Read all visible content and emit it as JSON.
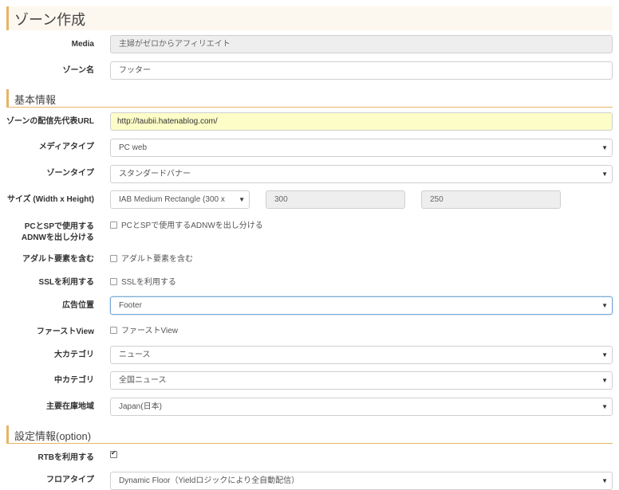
{
  "page": {
    "title": "ゾーン作成"
  },
  "fields": {
    "media": {
      "label": "Media",
      "value": "主婦がゼロからアフィリエイト"
    },
    "zone_name": {
      "label": "ゾーン名",
      "value": "フッター"
    }
  },
  "sections": {
    "basic": {
      "title": "基本情報"
    },
    "settings": {
      "title": "設定情報(option)"
    }
  },
  "basic": {
    "url": {
      "label": "ゾーンの配信先代表URL",
      "value": "http://taubii.hatenablog.com/"
    },
    "media_type": {
      "label": "メディアタイプ",
      "value": "PC web"
    },
    "zone_type": {
      "label": "ゾーンタイプ",
      "value": "スタンダードバナー"
    },
    "size": {
      "label": "サイズ (Width x Height)",
      "value": "IAB Medium Rectangle (300 x",
      "width": "300",
      "height": "250"
    },
    "split_adnw": {
      "label_line1": "PCとSPで使用する",
      "label_line2": "ADNWを出し分ける",
      "checkbox_label": "PCとSPで使用するADNWを出し分ける",
      "checked": false
    },
    "adult": {
      "label": "アダルト要素を含む",
      "checkbox_label": "アダルト要素を含む",
      "checked": false
    },
    "ssl": {
      "label": "SSLを利用する",
      "checkbox_label": "SSLを利用する",
      "checked": false
    },
    "ad_position": {
      "label": "広告位置",
      "value": "Footer"
    },
    "first_view": {
      "label": "ファーストView",
      "checkbox_label": "ファーストView",
      "checked": false
    },
    "category_main": {
      "label": "大カテゴリ",
      "value": "ニュース"
    },
    "category_sub": {
      "label": "中カテゴリ",
      "value": "全国ニュース"
    },
    "region": {
      "label": "主要在庫地域",
      "value": "Japan(日本)"
    }
  },
  "settings": {
    "rtb": {
      "label": "RTBを利用する",
      "checked": true
    },
    "floor_type": {
      "label": "フロアタイプ",
      "value": "Dynamic Floor（Yieldロジックにより全自動配信）"
    }
  },
  "icons": {
    "caret": "▼",
    "checkmark": "✔"
  }
}
